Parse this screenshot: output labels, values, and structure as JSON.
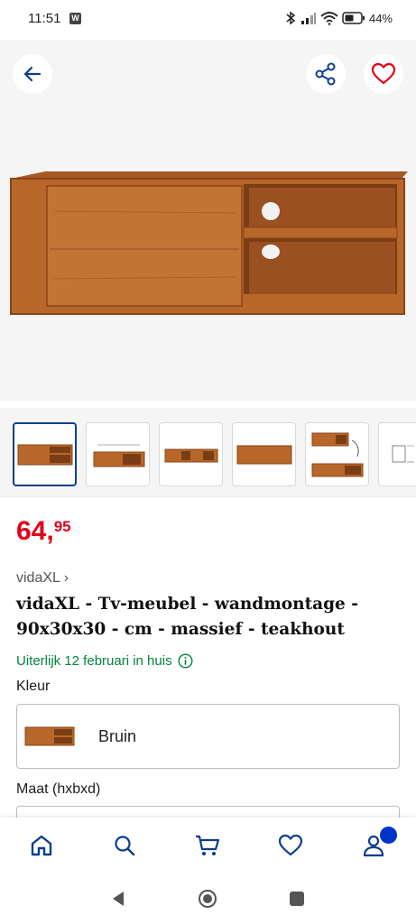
{
  "status_bar": {
    "time": "11:51",
    "app_badge": "W",
    "battery": "44%"
  },
  "gallery": {
    "icons": [
      "arrow-left-icon",
      "share-icon",
      "heart-icon"
    ],
    "thumbnail_count": 6,
    "selected_thumbnail": 1
  },
  "product": {
    "price_main": "64,",
    "price_cents": "95",
    "brand": "vidaXL",
    "brand_chevron": "›",
    "title": "vidaXL - Tv-meubel - wandmontage - 90x30x30 - cm - massief - teakhout",
    "delivery": "Uiterlijk 12 februari in huis"
  },
  "options": {
    "color_label": "Kleur",
    "color_value": "Bruin",
    "size_label": "Maat (hxbxd)"
  },
  "bottom_nav": {
    "items": [
      "home-icon",
      "search-icon",
      "cart-icon",
      "heart-icon",
      "account-icon"
    ],
    "active": "home-icon"
  },
  "colors": {
    "price": "#e2001a",
    "delivery": "#00843d",
    "accent": "#0b3d91",
    "badge": "#0033cc",
    "wood": "#b8672a"
  }
}
